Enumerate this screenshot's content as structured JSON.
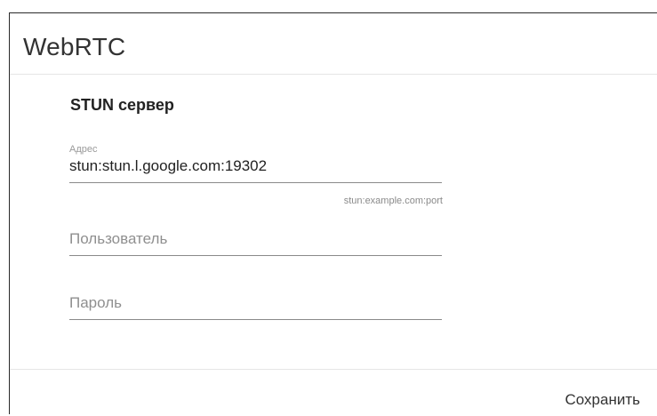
{
  "dialog": {
    "title": "WebRTC"
  },
  "stun": {
    "section_title": "STUN сервер",
    "address": {
      "label": "Адрес",
      "value": "stun:stun.l.google.com:19302",
      "hint": "stun:example.com:port"
    },
    "user": {
      "placeholder": "Пользователь",
      "value": ""
    },
    "password": {
      "placeholder": "Пароль",
      "value": ""
    }
  },
  "footer": {
    "save_label": "Сохранить"
  }
}
